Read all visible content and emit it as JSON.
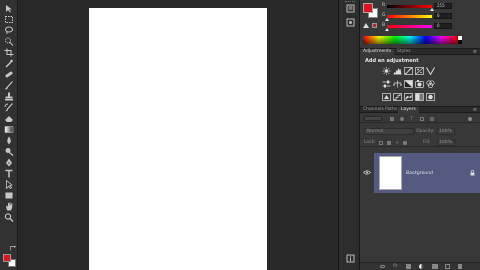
{
  "toolbar": {
    "tools": [
      {
        "icon": "move-tool-icon"
      },
      {
        "icon": "marquee-tool-icon"
      },
      {
        "icon": "lasso-tool-icon"
      },
      {
        "icon": "quick-selection-tool-icon"
      },
      {
        "icon": "crop-tool-icon"
      },
      {
        "icon": "eyedropper-tool-icon"
      },
      {
        "icon": "healing-brush-tool-icon"
      },
      {
        "icon": "brush-tool-icon"
      },
      {
        "icon": "clone-stamp-tool-icon"
      },
      {
        "icon": "history-brush-tool-icon"
      },
      {
        "icon": "eraser-tool-icon"
      },
      {
        "icon": "gradient-tool-icon"
      },
      {
        "icon": "blur-tool-icon"
      },
      {
        "icon": "dodge-tool-icon"
      },
      {
        "icon": "pen-tool-icon"
      },
      {
        "icon": "type-tool-icon"
      },
      {
        "icon": "path-selection-tool-icon"
      },
      {
        "icon": "rectangle-tool-icon"
      },
      {
        "icon": "hand-tool-icon"
      },
      {
        "icon": "zoom-tool-icon"
      }
    ],
    "foreground_color": "#e0141e",
    "background_color": "#ffffff"
  },
  "color_panel": {
    "foreground_color": "#e0141e",
    "background_color": "#ffffff",
    "channels": [
      {
        "label": "R",
        "value": "255"
      },
      {
        "label": "G",
        "value": "0"
      },
      {
        "label": "B",
        "value": "0"
      }
    ]
  },
  "adjustments_panel": {
    "tabs": [
      {
        "label": "Adjustments"
      },
      {
        "label": "Styles"
      }
    ],
    "heading": "Add an adjustment"
  },
  "layers_panel": {
    "tabs": [
      {
        "label": "Channels"
      },
      {
        "label": "Paths"
      },
      {
        "label": "Layers"
      }
    ],
    "blend_mode": "Normal",
    "opacity_label": "Opacity:",
    "opacity_value": "100%",
    "lock_label": "Lock:",
    "fill_label": "Fill:",
    "fill_value": "100%",
    "layers": [
      {
        "name": "Background",
        "visible": true,
        "locked": true
      }
    ]
  },
  "colors": {
    "accent_selection": "#545a80",
    "foreground": "#e0141e"
  }
}
